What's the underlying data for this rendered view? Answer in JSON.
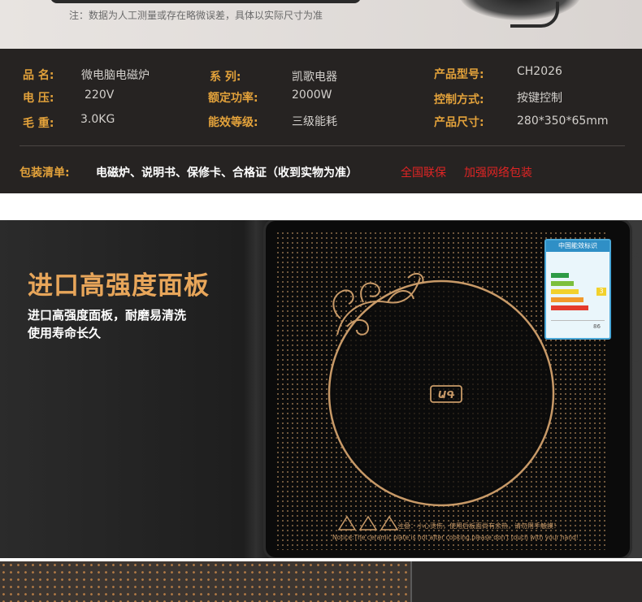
{
  "top": {
    "note": "注：数据为人工测量或存在略微误差，具体以实际尺寸为准"
  },
  "specs": {
    "product_name": {
      "label": "品    名:",
      "value": "微电脑电磁炉"
    },
    "voltage": {
      "label": "电    压:",
      "value": "220V"
    },
    "weight": {
      "label": "毛    重:",
      "value": "3.0KG"
    },
    "series": {
      "label": "系    列:",
      "value": "凯歌电器"
    },
    "power": {
      "label": "额定功率:",
      "value": "2000W"
    },
    "efficiency": {
      "label": "能效等级:",
      "value": "三级能耗"
    },
    "model": {
      "label": "产品型号:",
      "value": "CH2026"
    },
    "control": {
      "label": "控制方式:",
      "value": "按键控制"
    },
    "size": {
      "label": "产品尺寸:",
      "value": "280*350*65mm"
    }
  },
  "packing": {
    "label": "包装清单:",
    "items": "电磁炉、说明书、保修卡、合格证（收到实物为准）",
    "warranty": "全国联保",
    "package": "加强网络包装"
  },
  "panel": {
    "title": "进口高强度面板",
    "desc_line1": "进口高强度面板，耐磨易清洗",
    "desc_line2": "使用寿命长久",
    "energy_label_title": "中国能效标识",
    "energy_label_grade": "3",
    "energy_label_value": "86",
    "warning": "注意：小心烫伤，使用后板面尚有余热，请勿用手触摸！",
    "warning_en": "Notice:The ceramic plate is hot after cooking,please don't touch with your hand!"
  },
  "colors": {
    "accent_gold": "#e3a23b",
    "warning_red": "#e02424",
    "spec_bg": "#262322",
    "plate_gold": "#c89a68"
  }
}
